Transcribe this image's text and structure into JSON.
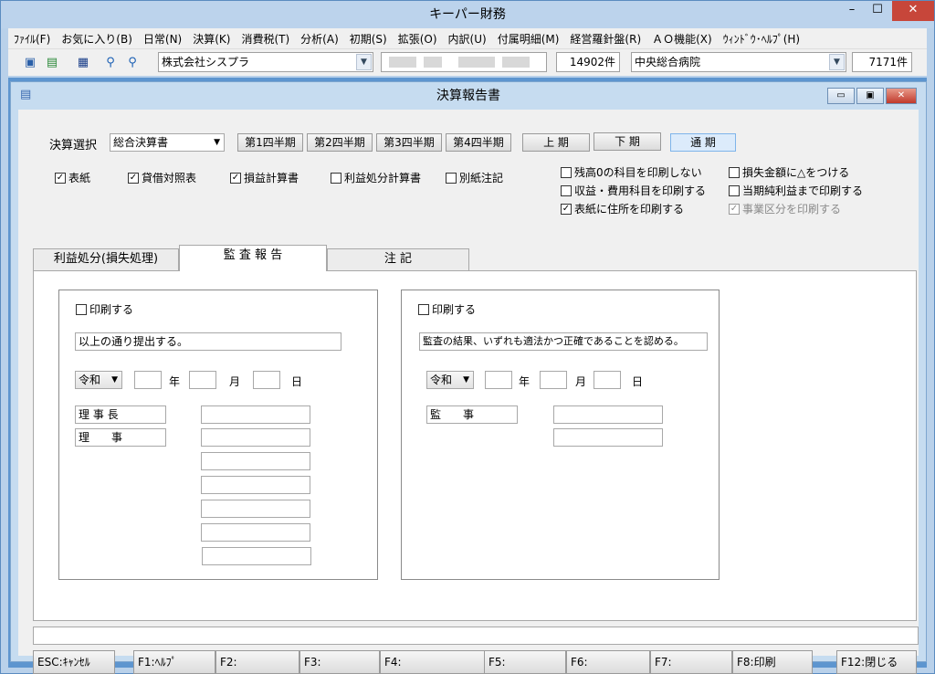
{
  "window": {
    "title": "キーパー財務"
  },
  "menu": [
    "ﾌｧｲﾙ(F)",
    "お気に入り(B)",
    "日常(N)",
    "決算(K)",
    "消費税(T)",
    "分析(A)",
    "初期(S)",
    "拡張(O)",
    "内訳(U)",
    "付属明細(M)",
    "経営羅針盤(R)",
    "ＡＯ機能(X)",
    "ｳｨﾝﾄﾞｳ･ﾍﾙﾌﾟ(H)"
  ],
  "toolbar": {
    "company": "株式会社シスプラ",
    "count1": "14902件",
    "hospital": "中央総合病院",
    "count2": "7171件"
  },
  "dialog": {
    "title": "決算報告書",
    "select_label": "決算選択",
    "select_value": "総合決算書",
    "period_buttons": [
      "第1四半期",
      "第2四半期",
      "第3四半期",
      "第4四半期",
      "上 期",
      "下 期",
      "通 期"
    ],
    "checks_left": [
      {
        "label": "表紙",
        "checked": "✓"
      },
      {
        "label": "貸借対照表",
        "checked": "✓"
      },
      {
        "label": "損益計算書",
        "checked": "✓"
      },
      {
        "label": "利益処分計算書",
        "checked": ""
      },
      {
        "label": "別紙注記",
        "checked": ""
      }
    ],
    "checks_right": [
      {
        "label": "残高0の科目を印刷しない",
        "checked": ""
      },
      {
        "label": "損失金額に△をつける",
        "checked": ""
      },
      {
        "label": "収益・費用科目を印刷する",
        "checked": ""
      },
      {
        "label": "当期純利益まで印刷する",
        "checked": ""
      },
      {
        "label": "表紙に住所を印刷する",
        "checked": "✓"
      },
      {
        "label": "事業区分を印刷する",
        "checked": "✓"
      }
    ],
    "tabs": [
      "利益処分(損失処理)",
      "監 査 報 告",
      "注 記"
    ],
    "left_group": {
      "print_label": "印刷する",
      "text": "以上の通り提出する。",
      "era": "令和",
      "year": "年",
      "month": "月",
      "day": "日",
      "titles": [
        "理 事 長",
        "理　　事"
      ]
    },
    "right_group": {
      "print_label": "印刷する",
      "text": "監査の結果、いずれも適法かつ正確であることを認める。",
      "era": "令和",
      "year": "年",
      "month": "月",
      "day": "日",
      "titles": [
        "監　　事"
      ]
    },
    "fkeys": [
      "ESC:ｷｬﾝｾﾙ",
      "F1:ﾍﾙﾌﾟ",
      "F2:",
      "F3:",
      "F4:",
      "F5:",
      "F6:",
      "F7:",
      "F8:印刷",
      "F12:閉じる"
    ]
  }
}
